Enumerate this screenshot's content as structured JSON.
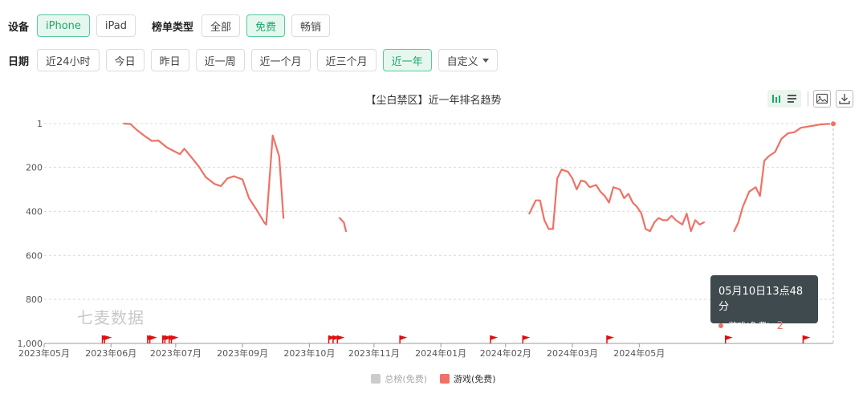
{
  "filters": {
    "device_label": "设备",
    "devices": [
      {
        "label": "iPhone",
        "active": true
      },
      {
        "label": "iPad",
        "active": false
      }
    ],
    "list_type_label": "榜单类型",
    "list_types": [
      {
        "label": "全部",
        "active": false
      },
      {
        "label": "免费",
        "active": true
      },
      {
        "label": "畅销",
        "active": false
      }
    ],
    "date_label": "日期",
    "dates": [
      {
        "label": "近24小时",
        "active": false
      },
      {
        "label": "今日",
        "active": false
      },
      {
        "label": "昨日",
        "active": false
      },
      {
        "label": "近一周",
        "active": false
      },
      {
        "label": "近一个月",
        "active": false
      },
      {
        "label": "近三个月",
        "active": false
      },
      {
        "label": "近一年",
        "active": true
      }
    ],
    "custom_label": "自定义"
  },
  "watermark": "七麦数据",
  "tooltip": {
    "time": "05月10日13点48分",
    "series": "游戏(免费)",
    "value": "2"
  },
  "colors": {
    "accent": "#1aa86a",
    "series_games": "#f07165",
    "series_total": "#cccccc",
    "flag": "#e01010"
  },
  "chart_data": {
    "type": "line",
    "title": "【尘白禁区】近一年排名趋势",
    "y_inverted": true,
    "ylim": [
      1,
      1000
    ],
    "y_ticks": [
      1,
      200,
      400,
      600,
      800,
      1000
    ],
    "y_tick_labels": [
      "1",
      "200",
      "400",
      "600",
      "800",
      "1,000"
    ],
    "x_range": [
      "2023-05-10",
      "2024-05-10"
    ],
    "x_ticks": [
      {
        "date": "2023-05-10",
        "label": "2023年05月"
      },
      {
        "date": "2023-06-10",
        "label": "2023年06月"
      },
      {
        "date": "2023-07-10",
        "label": "2023年07月"
      },
      {
        "date": "2023-08-10",
        "label": "2023年09月"
      },
      {
        "date": "2023-09-10",
        "label": "2023年10月"
      },
      {
        "date": "2023-10-10",
        "label": "2023年11月"
      },
      {
        "date": "2023-11-10",
        "label": "2024年01月"
      },
      {
        "date": "2023-12-10",
        "label": "2024年02月"
      },
      {
        "date": "2024-01-10",
        "label": "2024年03月"
      },
      {
        "date": "2024-02-10",
        "label": "2024年05月"
      }
    ],
    "grid": true,
    "legend_position": "bottom",
    "series": [
      {
        "name": "总榜(免费)",
        "active": false,
        "segments": []
      },
      {
        "name": "游戏(免费)",
        "active": true,
        "segments": [
          [
            [
              "2023-06-16",
              1
            ],
            [
              "2023-06-19",
              3
            ],
            [
              "2023-06-22",
              30
            ],
            [
              "2023-06-26",
              60
            ],
            [
              "2023-06-29",
              80
            ],
            [
              "2023-07-02",
              78
            ],
            [
              "2023-07-06",
              110
            ],
            [
              "2023-07-10",
              130
            ],
            [
              "2023-07-12",
              140
            ],
            [
              "2023-07-14",
              115
            ],
            [
              "2023-07-17",
              150
            ],
            [
              "2023-07-21",
              200
            ],
            [
              "2023-07-24",
              245
            ],
            [
              "2023-07-28",
              275
            ],
            [
              "2023-07-31",
              285
            ],
            [
              "2023-08-03",
              250
            ],
            [
              "2023-08-06",
              240
            ],
            [
              "2023-08-10",
              255
            ],
            [
              "2023-08-13",
              340
            ],
            [
              "2023-08-17",
              400
            ],
            [
              "2023-08-20",
              450
            ],
            [
              "2023-08-21",
              460
            ],
            [
              "2023-08-24",
              55
            ],
            [
              "2023-08-27",
              150
            ],
            [
              "2023-08-29",
              430
            ]
          ],
          [
            [
              "2023-09-24",
              430
            ],
            [
              "2023-09-26",
              450
            ],
            [
              "2023-09-27",
              490
            ]
          ],
          [
            [
              "2023-12-21",
              410
            ],
            [
              "2023-12-24",
              350
            ],
            [
              "2023-12-26",
              350
            ],
            [
              "2023-12-28",
              440
            ],
            [
              "2023-12-30",
              480
            ],
            [
              "2024-01-01",
              480
            ],
            [
              "2024-01-03",
              250
            ],
            [
              "2024-01-05",
              210
            ],
            [
              "2024-01-08",
              220
            ],
            [
              "2024-01-10",
              250
            ],
            [
              "2024-01-12",
              300
            ],
            [
              "2024-01-14",
              260
            ],
            [
              "2024-01-16",
              265
            ],
            [
              "2024-01-18",
              290
            ],
            [
              "2024-01-21",
              280
            ],
            [
              "2024-01-23",
              310
            ],
            [
              "2024-01-25",
              330
            ],
            [
              "2024-01-27",
              360
            ],
            [
              "2024-01-29",
              290
            ],
            [
              "2024-02-01",
              300
            ],
            [
              "2024-02-03",
              340
            ],
            [
              "2024-02-05",
              320
            ],
            [
              "2024-02-07",
              360
            ],
            [
              "2024-02-09",
              380
            ],
            [
              "2024-02-11",
              410
            ],
            [
              "2024-02-13",
              480
            ],
            [
              "2024-02-15",
              490
            ],
            [
              "2024-02-17",
              450
            ],
            [
              "2024-02-19",
              430
            ],
            [
              "2024-02-21",
              440
            ],
            [
              "2024-02-23",
              440
            ],
            [
              "2024-02-25",
              420
            ],
            [
              "2024-02-27",
              440
            ],
            [
              "2024-03-01",
              460
            ],
            [
              "2024-03-03",
              410
            ],
            [
              "2024-03-05",
              490
            ],
            [
              "2024-03-07",
              440
            ],
            [
              "2024-03-09",
              460
            ],
            [
              "2024-03-11",
              450
            ]
          ],
          [
            [
              "2024-03-25",
              490
            ],
            [
              "2024-03-27",
              450
            ],
            [
              "2024-03-29",
              380
            ],
            [
              "2024-04-01",
              310
            ],
            [
              "2024-04-04",
              290
            ],
            [
              "2024-04-06",
              330
            ],
            [
              "2024-04-08",
              170
            ],
            [
              "2024-04-10",
              150
            ],
            [
              "2024-04-13",
              130
            ],
            [
              "2024-04-16",
              70
            ],
            [
              "2024-04-19",
              45
            ],
            [
              "2024-04-22",
              40
            ],
            [
              "2024-04-25",
              20
            ],
            [
              "2024-04-28",
              15
            ],
            [
              "2024-05-01",
              10
            ],
            [
              "2024-05-04",
              5
            ],
            [
              "2024-05-07",
              3
            ],
            [
              "2024-05-10",
              2
            ]
          ]
        ]
      }
    ],
    "event_flags": [
      "2023-06-06",
      "2023-06-07",
      "2023-06-27",
      "2023-06-28",
      "2023-07-04",
      "2023-07-05",
      "2023-07-07",
      "2023-07-08",
      "2023-09-19",
      "2023-09-21",
      "2023-09-23",
      "2023-10-22",
      "2023-12-03",
      "2023-12-18",
      "2024-01-26",
      "2024-03-21",
      "2024-04-26"
    ],
    "highlight": {
      "date": "2024-05-10",
      "value": 2
    }
  }
}
